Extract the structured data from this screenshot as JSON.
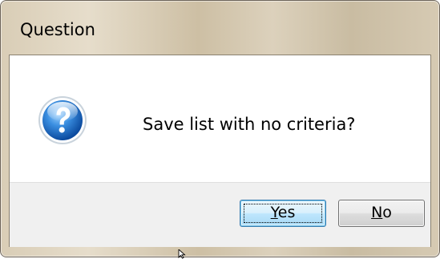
{
  "window": {
    "title": "Question"
  },
  "dialog": {
    "icon": "question-icon",
    "message": "Save list with no criteria?"
  },
  "buttons": {
    "yes": {
      "accel": "Y",
      "rest": "es"
    },
    "no": {
      "accel": "N",
      "rest": "o"
    }
  },
  "colors": {
    "icon_blue": "#2f7fd0",
    "focus_border": "#3c7fb1"
  }
}
